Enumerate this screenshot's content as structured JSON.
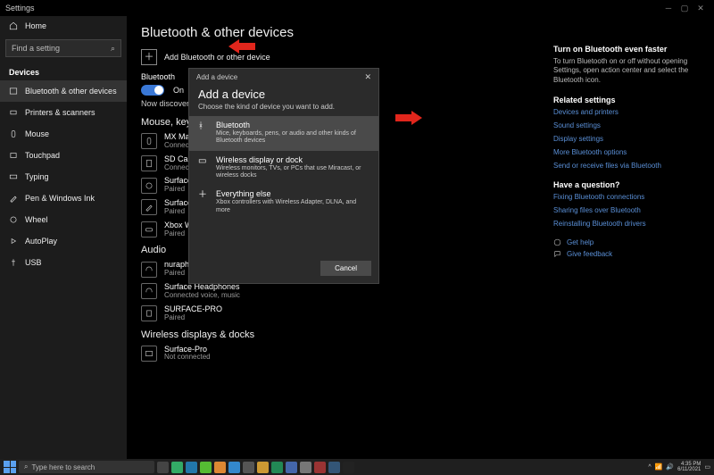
{
  "window": {
    "title": "Settings"
  },
  "sidebar": {
    "home": "Home",
    "search_placeholder": "Find a setting",
    "section": "Devices",
    "items": [
      {
        "label": "Bluetooth & other devices"
      },
      {
        "label": "Printers & scanners"
      },
      {
        "label": "Mouse"
      },
      {
        "label": "Touchpad"
      },
      {
        "label": "Typing"
      },
      {
        "label": "Pen & Windows Ink"
      },
      {
        "label": "Wheel"
      },
      {
        "label": "AutoPlay"
      },
      {
        "label": "USB"
      }
    ]
  },
  "page": {
    "title": "Bluetooth & other devices",
    "add_button": "Add Bluetooth or other device",
    "bt_label": "Bluetooth",
    "bt_state": "On",
    "discoverable": "Now discoverable as \"SURFACE",
    "sec_mouse": "Mouse, keyboard, & pen",
    "devices": [
      {
        "name": "MX Master 3",
        "sub": "Connected"
      },
      {
        "name": "SD Card",
        "sub": "Connected to USB 3.0"
      },
      {
        "name": "Surface Dial",
        "sub": "Paired"
      },
      {
        "name": "Surface Pen",
        "sub": "Paired"
      },
      {
        "name": "Xbox Wireless Controller",
        "sub": "Paired"
      }
    ],
    "sec_audio": "Audio",
    "audio_devices": [
      {
        "name": "nuraphone 983",
        "sub": "Paired"
      },
      {
        "name": "Surface Headphones",
        "sub": "Connected voice, music"
      },
      {
        "name": "SURFACE-PRO",
        "sub": "Paired"
      }
    ],
    "sec_wireless": "Wireless displays & docks",
    "wireless_devices": [
      {
        "name": "Surface-Pro",
        "sub": "Not connected"
      }
    ]
  },
  "right": {
    "faster_h": "Turn on Bluetooth even faster",
    "faster_p": "To turn Bluetooth on or off without opening Settings, open action center and select the Bluetooth icon.",
    "related_h": "Related settings",
    "related": [
      "Devices and printers",
      "Sound settings",
      "Display settings",
      "More Bluetooth options",
      "Send or receive files via Bluetooth"
    ],
    "question_h": "Have a question?",
    "question": [
      "Fixing Bluetooth connections",
      "Sharing files over Bluetooth",
      "Reinstalling Bluetooth drivers"
    ],
    "help": "Get help",
    "feedback": "Give feedback"
  },
  "modal": {
    "title": "Add a device",
    "heading": "Add a device",
    "sub": "Choose the kind of device you want to add.",
    "options": [
      {
        "title": "Bluetooth",
        "desc": "Mice, keyboards, pens, or audio and other kinds of Bluetooth devices"
      },
      {
        "title": "Wireless display or dock",
        "desc": "Wireless monitors, TVs, or PCs that use Miracast, or wireless docks"
      },
      {
        "title": "Everything else",
        "desc": "Xbox controllers with Wireless Adapter, DLNA, and more"
      }
    ],
    "cancel": "Cancel"
  },
  "taskbar": {
    "search": "Type here to search",
    "time": "4:35 PM",
    "date": "6/11/2021"
  }
}
